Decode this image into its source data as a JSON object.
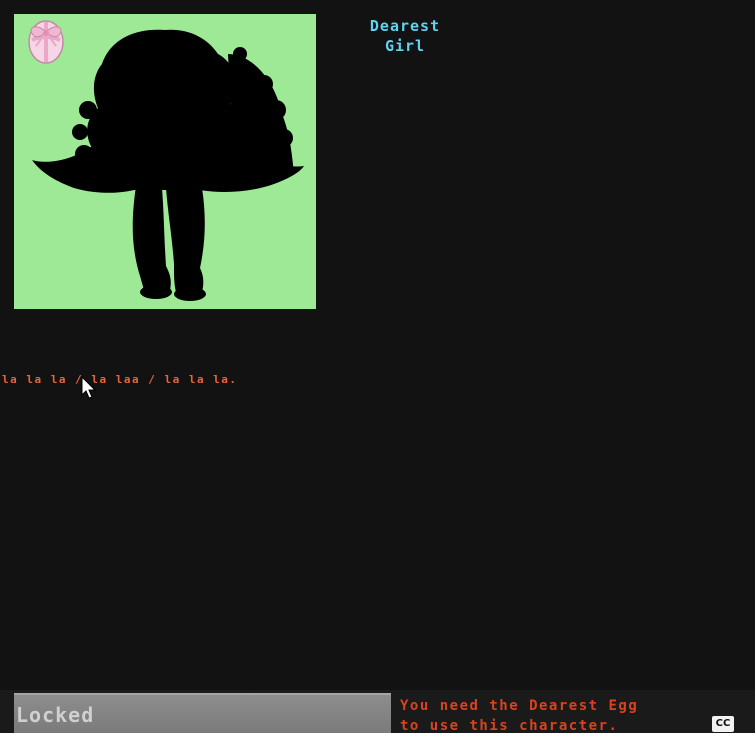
{
  "character": {
    "name": "Dearest\nGirl",
    "portrait_background": "#9de996",
    "silhouette_color": "#000000",
    "badge_icon": "egg-with-ribbon-icon"
  },
  "lyrics": "la la la / la laa / la la la.",
  "locked_button": {
    "label": "Locked"
  },
  "requirement": {
    "text": "You need the Dearest Egg\nto use this character."
  },
  "cc_button": {
    "label": "CC"
  },
  "colors": {
    "name_text": "#5fd3f0",
    "lyrics_text": "#e8643c",
    "requirement_text": "#d9431f",
    "locked_text": "#d0d0d0",
    "background": "#121212"
  }
}
